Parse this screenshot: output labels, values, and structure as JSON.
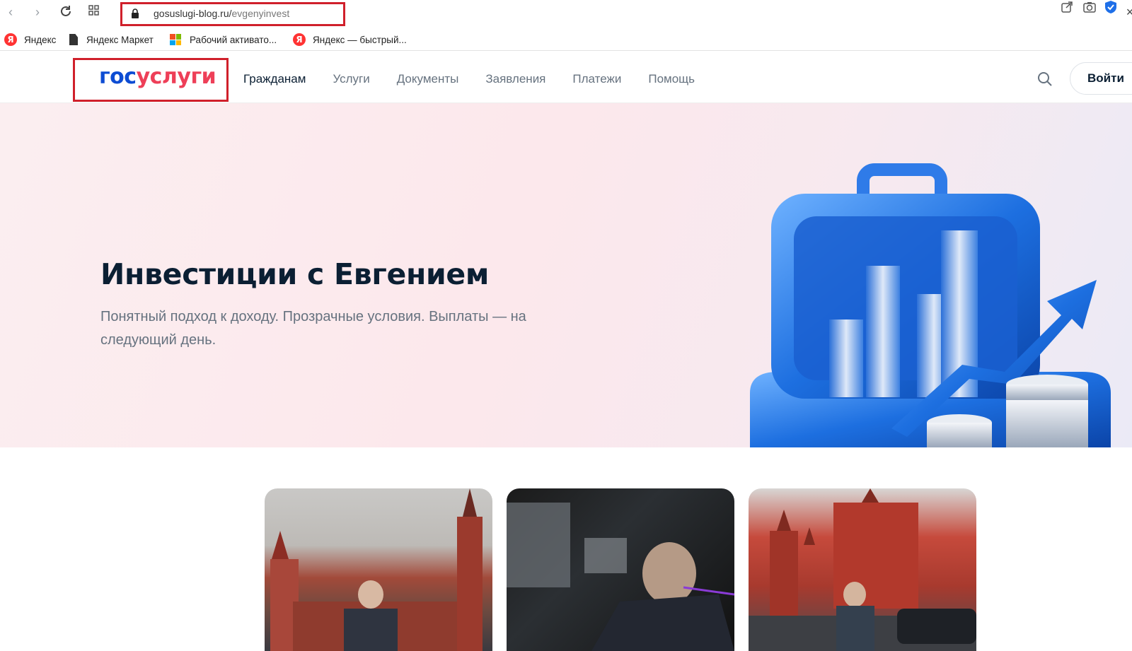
{
  "browser": {
    "url_host": "gosuslugi-blog.ru/",
    "url_path": "evgenyinvest",
    "bookmarks": [
      {
        "label": "Яндекс",
        "icon": "yandex-icon"
      },
      {
        "label": "Яндекс Маркет",
        "icon": "document-icon"
      },
      {
        "label": "Рабочий активато...",
        "icon": "windows-icon"
      },
      {
        "label": "Яндекс — быстрый...",
        "icon": "yandex-icon"
      }
    ]
  },
  "site": {
    "logo_part1": "гос",
    "logo_part2": "услуги",
    "menu": [
      "Гражданам",
      "Услуги",
      "Документы",
      "Заявления",
      "Платежи",
      "Помощь"
    ],
    "login_label": "Войти"
  },
  "hero": {
    "title": "Инвестиции с Евгением",
    "subtitle": "Понятный подход к доходу. Прозрачные условия. Выплаты — на следующий день."
  },
  "colors": {
    "brand_blue": "#0d4cd3",
    "brand_red": "#ee3f58",
    "highlight_border": "#d0202b"
  }
}
